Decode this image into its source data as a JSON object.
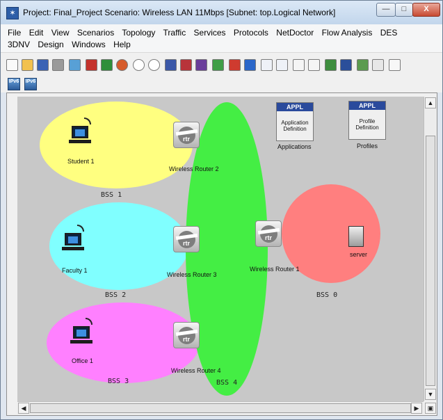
{
  "window": {
    "title": "Project: Final_Project Scenario: Wireless LAN 11Mbps  [Subnet: top.Logical Network]",
    "minimize_glyph": "—",
    "maximize_glyph": "□",
    "close_glyph": "X"
  },
  "menu": {
    "row1": [
      "File",
      "Edit",
      "View",
      "Scenarios",
      "Topology",
      "Traffic",
      "Services",
      "Protocols",
      "NetDoctor",
      "Flow Analysis",
      "DES"
    ],
    "row2": [
      "3DNV",
      "Design",
      "Windows",
      "Help"
    ]
  },
  "toolbar": {
    "icons": [
      "new-icon",
      "open-icon",
      "save-icon",
      "print-icon",
      "configure-icon",
      "stop-icon",
      "record-icon",
      "breakpoint-icon",
      "zoom-in-icon",
      "zoom-out-icon",
      "ace-icon",
      "cfg-icon",
      "vne-icon",
      "statistics-icon",
      "flag-icon",
      "warning-icon",
      "select-icon",
      "select-all-icon",
      "pointer-icon",
      "topology-icon",
      "results-icon",
      "ers-icon",
      "report-icon",
      "graph-icon",
      "rack-icon"
    ],
    "ipv6": [
      "IPv6",
      "IPv6"
    ]
  },
  "network": {
    "bss": {
      "bss1": "BSS 1",
      "bss2": "BSS 2",
      "bss3": "BSS 3",
      "bss4": "BSS 4",
      "bss0": "BSS 0"
    },
    "routers": {
      "r1": "Wireless Router 1",
      "r2": "Wireless Router 2",
      "r3": "Wireless Router 3",
      "r4": "Wireless Router 4",
      "rtr_text": "rtr"
    },
    "hosts": {
      "student": "Student 1",
      "faculty": "Faculty 1",
      "office": "Office 1",
      "server": "server"
    },
    "applications": {
      "header": "APPL",
      "body": "Application Definition",
      "caption": "Applications"
    },
    "profiles": {
      "header": "APPL",
      "body": "Profile Definition",
      "caption": "Profiles"
    },
    "colors": {
      "bss1": "#ffff80",
      "bss2": "#80ffff",
      "bss3": "#ff80ff",
      "bss4": "#44ee44",
      "bss0": "#ff7f7f",
      "canvas": "#c8c8c8"
    }
  }
}
